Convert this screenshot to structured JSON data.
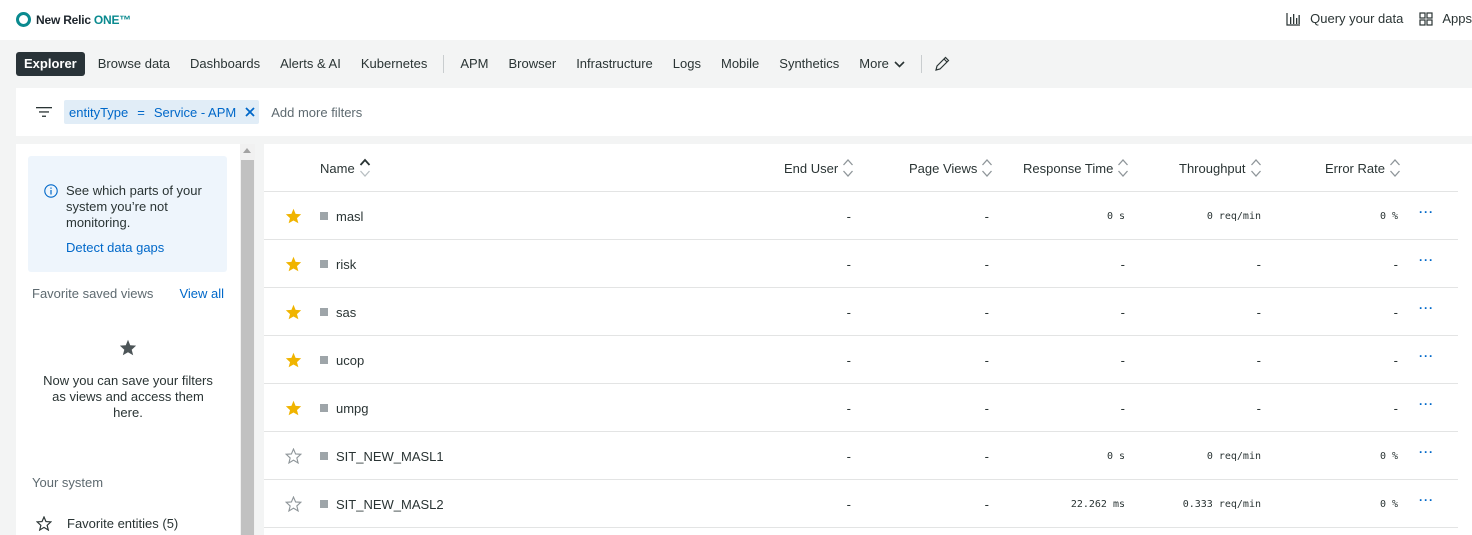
{
  "app": {
    "brand": "New Relic",
    "brand_one": "ONE™"
  },
  "topbar": {
    "query_label": "Query your data",
    "apps_label": "Apps"
  },
  "nav": {
    "items": [
      "Explorer",
      "Browse data",
      "Dashboards",
      "Alerts & AI",
      "Kubernetes",
      "APM",
      "Browser",
      "Infrastructure",
      "Logs",
      "Mobile",
      "Synthetics"
    ],
    "more_label": "More"
  },
  "filter": {
    "key": "entityType",
    "operator": "=",
    "value": "Service - APM",
    "add_placeholder": "Add more filters"
  },
  "sidebar": {
    "info_text": "See which parts of your system you’re not monitoring.",
    "info_link": "Detect data gaps",
    "favorites_title": "Favorite saved views",
    "view_all": "View all",
    "empty_text": "Now you can save your filters as views and access them here.",
    "your_system": "Your system",
    "favorite_entities": "Favorite entities (5)"
  },
  "table": {
    "columns": {
      "name": "Name",
      "end_user": "End User",
      "page_views": "Page Views",
      "response_time": "Response Time",
      "throughput": "Throughput",
      "error_rate": "Error Rate"
    },
    "rows": [
      {
        "favorite": true,
        "name": "masl",
        "end_user": "-",
        "page_views": "-",
        "response_time": "0 s",
        "throughput": "0 req/min",
        "error_rate": "0 %"
      },
      {
        "favorite": true,
        "name": "risk",
        "end_user": "-",
        "page_views": "-",
        "response_time": "-",
        "throughput": "-",
        "error_rate": "-"
      },
      {
        "favorite": true,
        "name": "sas",
        "end_user": "-",
        "page_views": "-",
        "response_time": "-",
        "throughput": "-",
        "error_rate": "-"
      },
      {
        "favorite": true,
        "name": "ucop",
        "end_user": "-",
        "page_views": "-",
        "response_time": "-",
        "throughput": "-",
        "error_rate": "-"
      },
      {
        "favorite": true,
        "name": "umpg",
        "end_user": "-",
        "page_views": "-",
        "response_time": "-",
        "throughput": "-",
        "error_rate": "-"
      },
      {
        "favorite": false,
        "name": "SIT_NEW_MASL1",
        "end_user": "-",
        "page_views": "-",
        "response_time": "0 s",
        "throughput": "0 req/min",
        "error_rate": "0 %"
      },
      {
        "favorite": false,
        "name": "SIT_NEW_MASL2",
        "end_user": "-",
        "page_views": "-",
        "response_time": "22.262 ms",
        "throughput": "0.333 req/min",
        "error_rate": "0 %"
      }
    ],
    "row_menu": "···"
  },
  "colors": {
    "accent": "#0a8a8f",
    "link": "#0068c9",
    "star": "#f0b400",
    "nav_active": "#293338"
  }
}
